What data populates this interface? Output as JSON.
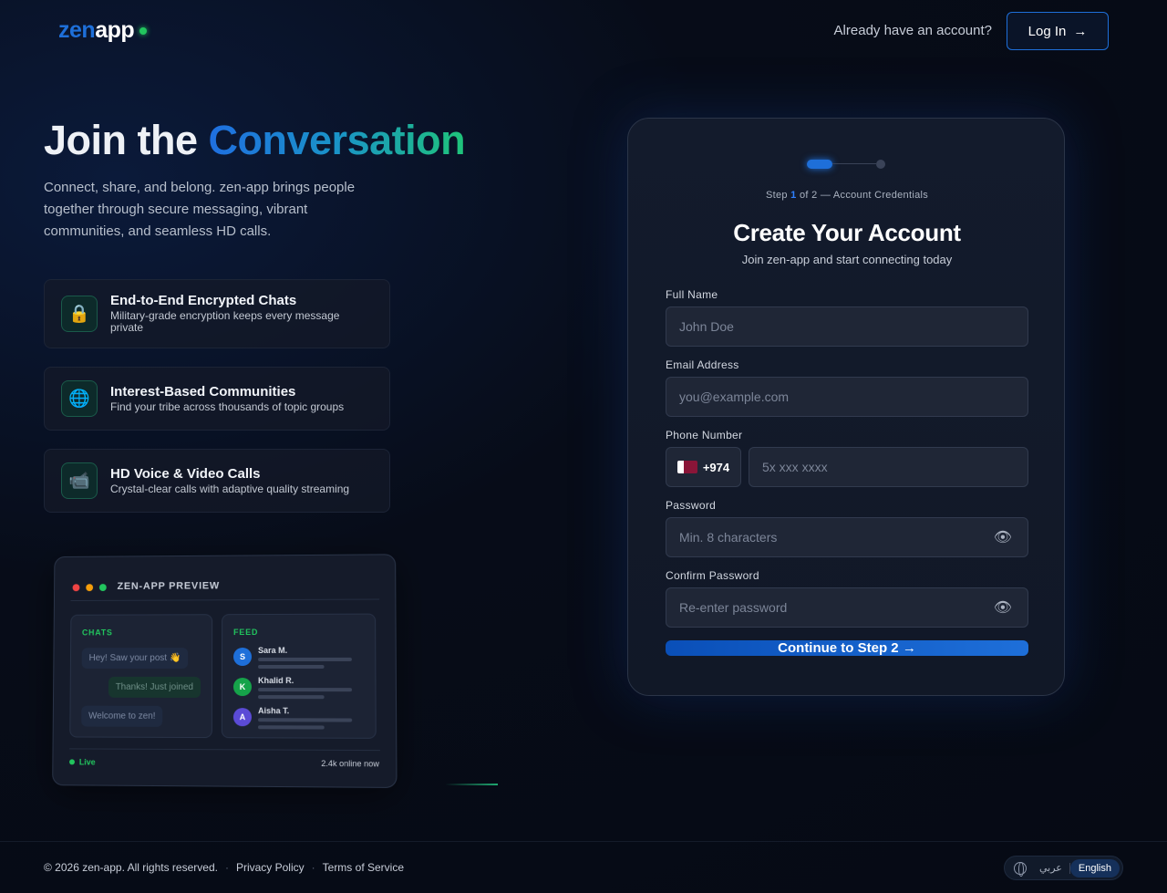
{
  "header": {
    "logo_zen": "zen",
    "logo_app": "app",
    "already": "Already have an account?",
    "login_label": "Log In",
    "login_arrow": "→"
  },
  "hero": {
    "title_plain": "Join the",
    "title_highlight": "Conversation",
    "description": "Connect, share, and belong. zen-app brings people together through secure messaging, vibrant communities, and seamless HD calls.",
    "features": [
      {
        "icon": "lock-icon",
        "glyph": "🔒",
        "title": "End-to-End Encrypted Chats",
        "desc": "Military-grade encryption keeps every message private"
      },
      {
        "icon": "globe-icon",
        "glyph": "🌐",
        "title": "Interest-Based Communities",
        "desc": "Find your tribe across thousands of topic groups"
      },
      {
        "icon": "video-camera-icon",
        "glyph": "📹",
        "title": "HD Voice & Video Calls",
        "desc": "Crystal-clear calls with adaptive quality streaming"
      }
    ]
  },
  "preview": {
    "title": "ZEN-APP PREVIEW",
    "chats_label": "CHATS",
    "feed_label": "FEED",
    "messages": [
      "Hey! Saw your post 👋",
      "Thanks! Just joined",
      "Welcome to zen!"
    ],
    "feed": [
      {
        "initial": "S",
        "name": "Sara M.",
        "color": "#1e6fd9"
      },
      {
        "initial": "K",
        "name": "Khalid R.",
        "color": "#16a34a"
      },
      {
        "initial": "A",
        "name": "Aisha T.",
        "color": "#5b4bd6"
      }
    ],
    "live": "Live",
    "online": "2.4k online now"
  },
  "signup": {
    "step_prefix": "Step",
    "step_current": "1",
    "step_suffix": "of 2 — Account Credentials",
    "title": "Create Your Account",
    "subtitle": "Join zen-app and start connecting today",
    "fields": {
      "full_name": {
        "label": "Full Name",
        "placeholder": "John Doe"
      },
      "email": {
        "label": "Email Address",
        "placeholder": "you@example.com"
      },
      "phone": {
        "label": "Phone Number",
        "code": "+974",
        "placeholder": "5x xxx xxxx"
      },
      "password": {
        "label": "Password",
        "placeholder": "Min. 8 characters"
      },
      "confirm": {
        "label": "Confirm Password",
        "placeholder": "Re-enter password"
      }
    },
    "submit": "Continue to Step 2 →"
  },
  "footer": {
    "copyright": "© 2026 zen-app. All rights reserved.",
    "privacy": "Privacy Policy",
    "terms": "Terms of Service",
    "lang_ar": "عربي",
    "lang_en": "English"
  },
  "colors": {
    "accent": "#1e6fd9",
    "success": "#22c55e"
  }
}
